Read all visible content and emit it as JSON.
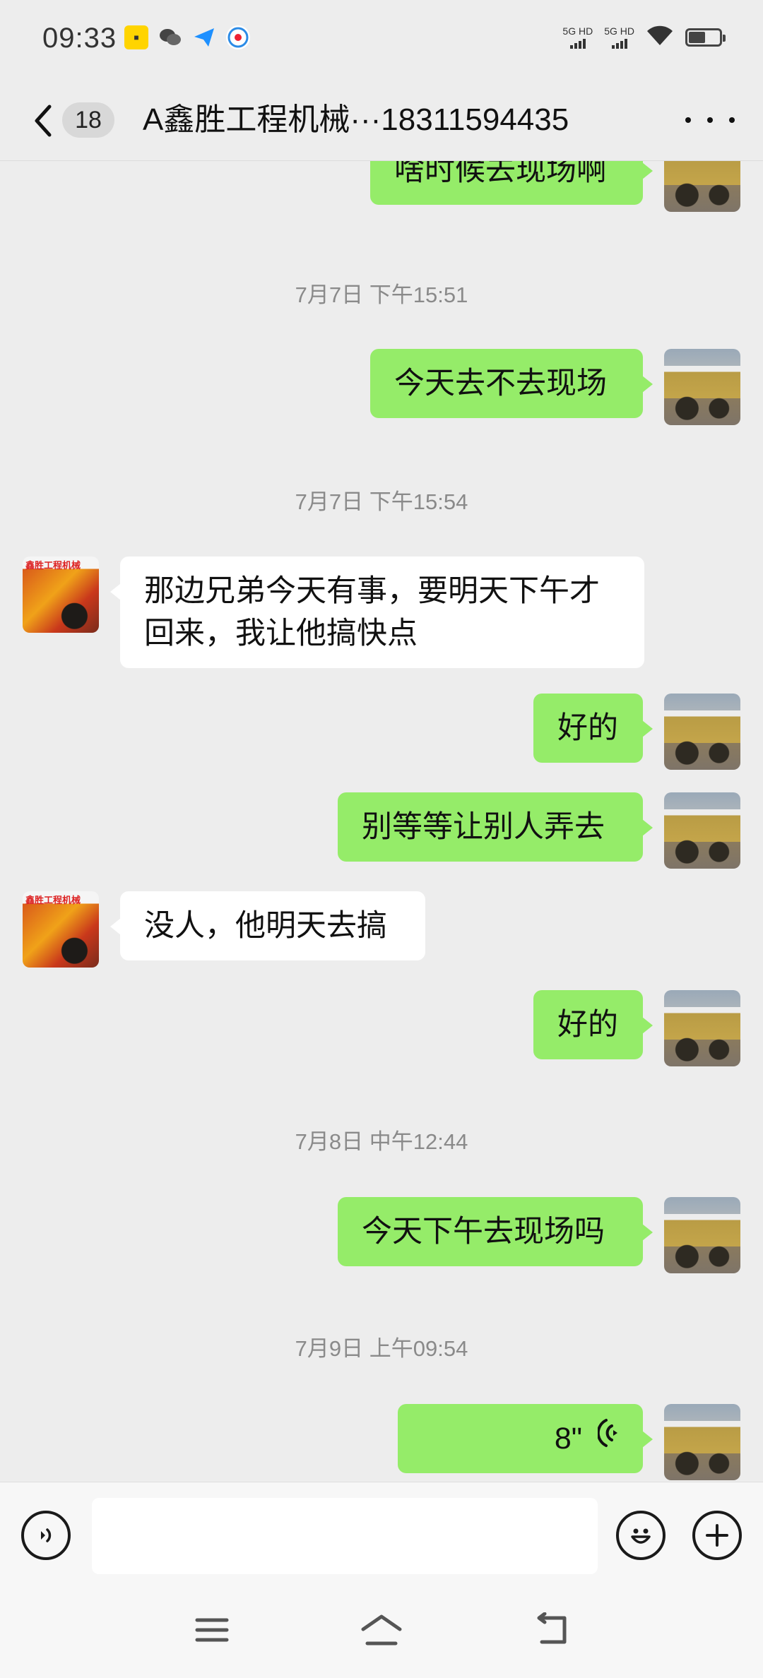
{
  "status_bar": {
    "time": "09:33",
    "notification_icons": [
      "app-icon",
      "wechat-icon",
      "send-icon",
      "browser-icon"
    ],
    "network_labels": [
      "5G HD",
      "5G HD"
    ],
    "wifi_icon": "wifi-icon",
    "battery_level_percent": 55
  },
  "header": {
    "back_icon": "chevron-left-icon",
    "unread_count": "18",
    "title": "A鑫胜工程机械···18311594435",
    "more_icon": "more-dots-icon"
  },
  "messages": [
    {
      "type": "text",
      "side": "me",
      "text": "啥时候去现场啊"
    },
    {
      "type": "timestamp",
      "text": "7月7日 下午15:51"
    },
    {
      "type": "text",
      "side": "me",
      "text": "今天去不去现场"
    },
    {
      "type": "timestamp",
      "text": "7月7日 下午15:54"
    },
    {
      "type": "text",
      "side": "other",
      "lines": [
        "那边兄弟今天有事，要明天下午才",
        "回来，我让他搞快点"
      ]
    },
    {
      "type": "text",
      "side": "me",
      "text": "好的"
    },
    {
      "type": "text",
      "side": "me",
      "text": "别等等让别人弄去"
    },
    {
      "type": "text",
      "side": "other",
      "text": "没人，他明天去搞"
    },
    {
      "type": "text",
      "side": "me",
      "text": "好的"
    },
    {
      "type": "timestamp",
      "text": "7月8日 中午12:44"
    },
    {
      "type": "text",
      "side": "me",
      "text": "今天下午去现场吗"
    },
    {
      "type": "timestamp",
      "text": "7月9日 上午09:54"
    },
    {
      "type": "voice",
      "side": "me",
      "duration": "8\""
    }
  ],
  "other_avatar_stamp": "鑫胜工程机械",
  "input_bar": {
    "voice_icon": "voice-input-icon",
    "text_value": "",
    "emoji_icon": "emoji-icon",
    "plus_icon": "plus-icon"
  },
  "nav_bar": {
    "menu_icon": "menu-icon",
    "home_icon": "home-icon",
    "back_icon": "back-icon"
  },
  "colors": {
    "background": "#ededed",
    "my_bubble": "#95ec69",
    "other_bubble": "#ffffff",
    "timestamp_text": "#8a8a8a"
  }
}
